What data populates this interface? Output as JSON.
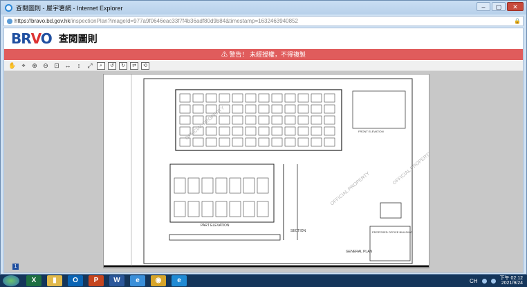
{
  "window": {
    "title": "查閱圖則 - 屋宇署網 - Internet Explorer",
    "controls": {
      "minimize": "–",
      "maximize": "▢",
      "close": "✕"
    }
  },
  "address": {
    "url_prefix": "https://bravo.bd.gov.hk",
    "url_rest": "/inspectionPlan?imageId=977a9f0646eac33f7f4b36adf80d9b84&timestamp=1632463940852"
  },
  "header": {
    "logo": {
      "part1": "BR",
      "part2": "V",
      "part3": "O"
    },
    "title": "查閱圖則"
  },
  "warning": {
    "text": "⚠ 警告！ 未經授權，不得複製"
  },
  "toolbar": {
    "tools": [
      {
        "name": "hand-pan-icon",
        "glyph": "✋"
      },
      {
        "name": "select-icon",
        "glyph": "⌖"
      },
      {
        "name": "zoom-in-icon",
        "glyph": "⊕"
      },
      {
        "name": "zoom-out-icon",
        "glyph": "⊖"
      },
      {
        "name": "zoom-window-icon",
        "glyph": "⊡"
      },
      {
        "name": "fit-width-icon",
        "glyph": "↔"
      },
      {
        "name": "fit-height-icon",
        "glyph": "↕"
      },
      {
        "name": "fit-page-icon",
        "glyph": "⤢"
      },
      {
        "name": "magnifier-icon",
        "glyph": "⌕"
      },
      {
        "name": "rotate-left-icon",
        "glyph": "↺"
      },
      {
        "name": "rotate-right-icon",
        "glyph": "↻"
      },
      {
        "name": "flip-icon",
        "glyph": "⇄"
      },
      {
        "name": "reset-icon",
        "glyph": "⟲"
      }
    ]
  },
  "viewer": {
    "page_badge": "1"
  },
  "drawing": {
    "label_main": "PART ELEVATION",
    "label_section": "SECTION",
    "label_plan": "GENERAL PLAN",
    "label_elev_small": "FRONT ELEVATION",
    "title_block": "PROPOSED OFFICE BUILDING",
    "stamp_text": "OFFICIAL PROPERTY"
  },
  "taskbar": {
    "apps": [
      {
        "name": "excel-app",
        "glyph": "X",
        "color": "#1d6f42"
      },
      {
        "name": "explorer-app",
        "glyph": "▮",
        "color": "#e0b84a"
      },
      {
        "name": "outlook-app",
        "glyph": "O",
        "color": "#0a64b4"
      },
      {
        "name": "powerpoint-app",
        "glyph": "P",
        "color": "#c5451f"
      },
      {
        "name": "word-app",
        "glyph": "W",
        "color": "#2b579a"
      },
      {
        "name": "ie-app",
        "glyph": "e",
        "color": "#3a8fd9"
      },
      {
        "name": "chrome-app",
        "glyph": "◉",
        "color": "#d7a52a"
      },
      {
        "name": "edge-app",
        "glyph": "e",
        "color": "#1f8ad4"
      }
    ],
    "input_lang": "CH",
    "clock_time": "下午 02:12",
    "clock_date": "2021/9/24"
  }
}
